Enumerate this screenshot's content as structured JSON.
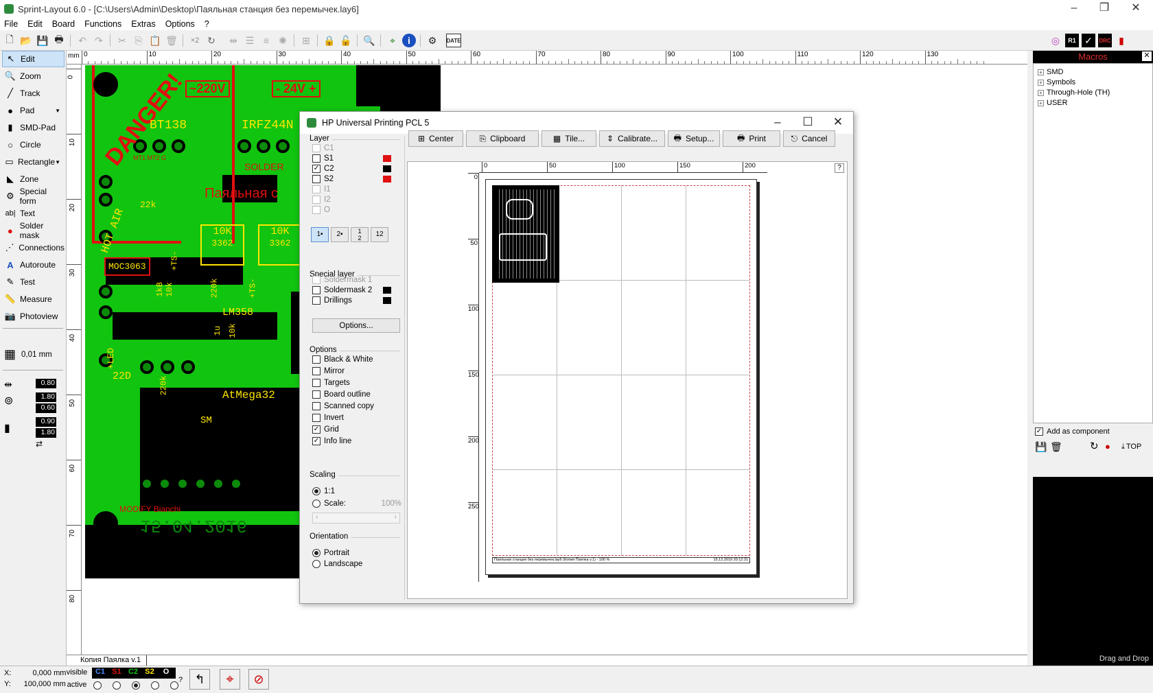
{
  "window": {
    "title": "Sprint-Layout 6.0 - [C:\\Users\\Admin\\Desktop\\Паяльная станция без перемычек.lay6]"
  },
  "menu": [
    "File",
    "Edit",
    "Board",
    "Functions",
    "Extras",
    "Options",
    "?"
  ],
  "toolbar": {
    "date_label": "DATE",
    "r1_label": "R1",
    "drc_label": "DRC"
  },
  "tools": [
    {
      "label": "Edit",
      "icon": "pointer-icon"
    },
    {
      "label": "Zoom",
      "icon": "zoom-icon"
    },
    {
      "label": "Track",
      "icon": "track-icon"
    },
    {
      "label": "Pad",
      "icon": "pad-icon"
    },
    {
      "label": "SMD-Pad",
      "icon": "smd-pad-icon"
    },
    {
      "label": "Circle",
      "icon": "circle-icon"
    },
    {
      "label": "Rectangle",
      "icon": "rectangle-icon"
    },
    {
      "label": "Zone",
      "icon": "zone-icon"
    },
    {
      "label": "Special form",
      "icon": "special-form-icon"
    },
    {
      "label": "Text",
      "icon": "text-icon"
    },
    {
      "label": "Solder mask",
      "icon": "solder-mask-icon"
    },
    {
      "label": "Connections",
      "icon": "connections-icon"
    },
    {
      "label": "Autoroute",
      "icon": "autoroute-icon"
    },
    {
      "label": "Test",
      "icon": "test-icon"
    },
    {
      "label": "Measure",
      "icon": "measure-icon"
    },
    {
      "label": "Photoview",
      "icon": "photoview-icon"
    }
  ],
  "grid": {
    "value": "0,01 mm"
  },
  "track_width": {
    "value": "0.80"
  },
  "pad_sizes": {
    "outer": "1.80",
    "inner": "0.60"
  },
  "smd_sizes": {
    "w": "0.90",
    "h": "1.80"
  },
  "ruler": {
    "unit": "mm",
    "h_ticks": [
      "0",
      "10",
      "20",
      "30",
      "40",
      "50",
      "60",
      "70",
      "80",
      "90",
      "100",
      "110",
      "120",
      "130"
    ],
    "v_ticks": [
      "0",
      "10",
      "20",
      "30",
      "40",
      "50",
      "60",
      "70",
      "80"
    ]
  },
  "pcb": {
    "danger": "DANGER!",
    "v220": "~220V",
    "v24": "- 24V +",
    "bt138": "BT138",
    "irfz": "IRFZ44N",
    "hotair": "HOT AIR",
    "r22k": "22k",
    "mt": "MT1  MT2  G",
    "solder": "SOLDER",
    "rus": "Паяльная с",
    "r10k_a": "10K",
    "r3362_a": "3362",
    "r10k_b": "10K",
    "r3362_b": "3362",
    "moc": "MOC3063",
    "tst": "+TS-",
    "r1k": "1kB",
    "r10k": "10k",
    "r220k": "220k",
    "c1u": "1u",
    "tst2": "+TS-",
    "lm358": "LM358",
    "c10k": "10k",
    "led": "+LED",
    "c22d": "22D",
    "r220k2": "220k",
    "atmega": "AtMega32",
    "date": "15.04.2016",
    "author": "MODIFY Bianchi",
    "sm": "SM"
  },
  "tab": {
    "label": "Копия Паялка v.1"
  },
  "status": {
    "x_label": "X:",
    "x": "0,000 mm",
    "y_label": "Y:",
    "y": "100,000 mm",
    "visible": "visible",
    "active": "active",
    "layers": [
      "C1",
      "S1",
      "C2",
      "S2",
      "O"
    ],
    "help": "?"
  },
  "macros": {
    "title": "Macros",
    "items": [
      "SMD",
      "Symbols",
      "Through-Hole (TH)",
      "USER"
    ],
    "add_component": "Add as component",
    "top": "TOP",
    "drag_drop": "Drag and Drop"
  },
  "dialog": {
    "title": "HP Universal Printing PCL 5",
    "layer_label": "Layer",
    "layers": [
      {
        "name": "C1",
        "checked": false,
        "disabled": true
      },
      {
        "name": "S1",
        "checked": false,
        "disabled": false,
        "color": "#e01010"
      },
      {
        "name": "C2",
        "checked": true,
        "disabled": false,
        "color": "#000000"
      },
      {
        "name": "S2",
        "checked": false,
        "disabled": false,
        "color": "#e01010"
      },
      {
        "name": "I1",
        "checked": false,
        "disabled": true
      },
      {
        "name": "I2",
        "checked": false,
        "disabled": true
      },
      {
        "name": "O",
        "checked": false,
        "disabled": true
      }
    ],
    "special_label": "Special layer",
    "special": [
      {
        "name": "Soldermask 1",
        "checked": false,
        "disabled": true
      },
      {
        "name": "Soldermask 2",
        "checked": false,
        "disabled": false,
        "color": "#000000"
      },
      {
        "name": "Drillings",
        "checked": false,
        "disabled": false,
        "color": "#000000"
      }
    ],
    "options_button": "Options...",
    "options_label": "Options",
    "options": [
      {
        "name": "Black & White",
        "checked": false
      },
      {
        "name": "Mirror",
        "checked": false
      },
      {
        "name": "Targets",
        "checked": false
      },
      {
        "name": "Board outline",
        "checked": false
      },
      {
        "name": "Scanned copy",
        "checked": false
      },
      {
        "name": "Invert",
        "checked": false
      },
      {
        "name": "Grid",
        "checked": true
      },
      {
        "name": "Info line",
        "checked": true
      }
    ],
    "scaling_label": "Scaling",
    "scale_1_1": "1:1",
    "scale_custom": "Scale:",
    "scale_value": "100%",
    "orientation_label": "Orientation",
    "portrait": "Portrait",
    "landscape": "Landscape",
    "buttons": {
      "center": "Center",
      "clipboard": "Clipboard",
      "tile": "Tile...",
      "calibrate": "Calibrate...",
      "setup": "Setup...",
      "print": "Print",
      "cancel": "Cancel"
    },
    "help": "?",
    "preview_h_ticks": [
      "0",
      "50",
      "100",
      "150",
      "200"
    ],
    "preview_v_ticks": [
      "0",
      "50",
      "100",
      "150",
      "200",
      "250"
    ],
    "info_line": "Паяльная станция без перемычек.lay6 (Копия Паялка v.1) - 100 %",
    "info_date": "15.12.2019 20:12:31"
  },
  "colors": {
    "board_green": "#11c40f",
    "yellow": "#ffe600",
    "red": "#e01010",
    "macro_title": "#e03030"
  }
}
